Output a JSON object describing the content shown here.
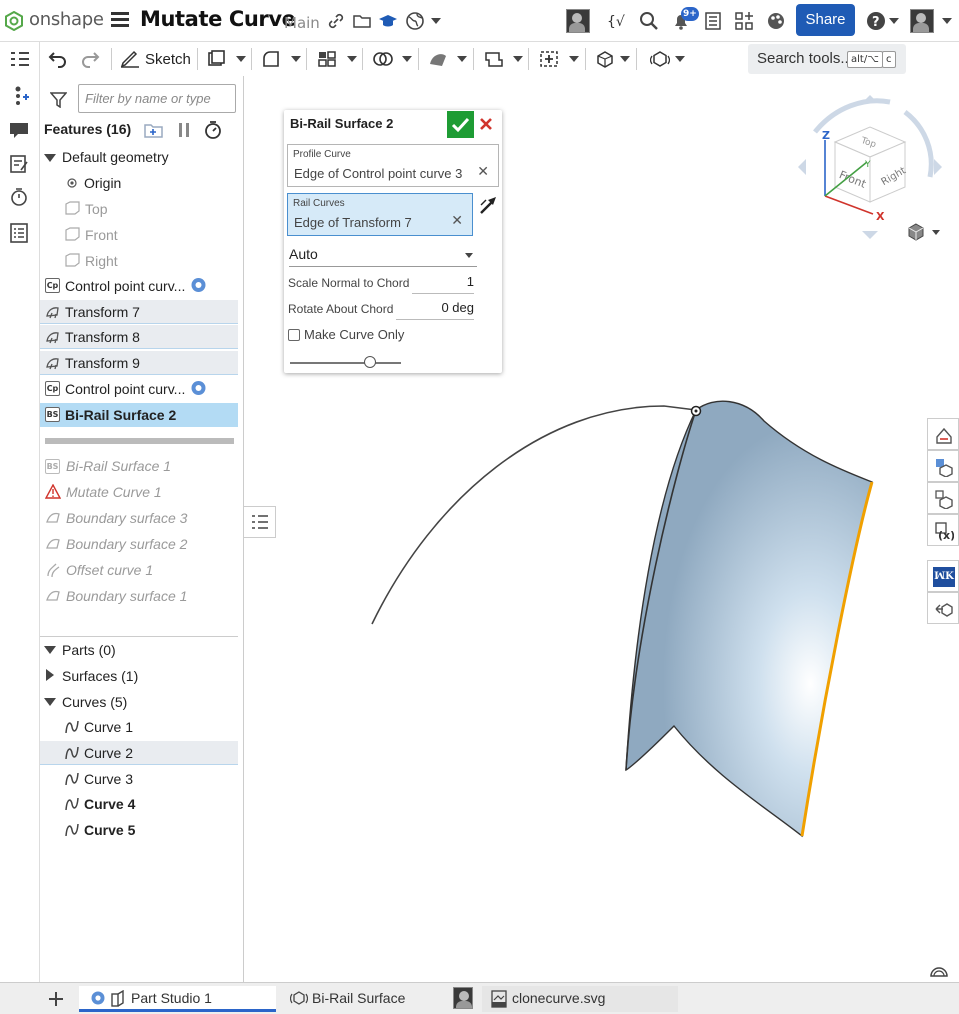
{
  "app": {
    "brand": "onshape",
    "document_title": "Mutate Curve",
    "branch": "Main",
    "notification_count": "9+",
    "share_label": "Share"
  },
  "toolbar": {
    "sketch_label": "Sketch",
    "search_label": "Search tools...",
    "search_shortcut_1": "alt/⌥",
    "search_shortcut_2": "c"
  },
  "features": {
    "filter_placeholder": "Filter by name or type",
    "header": "Features (16)",
    "default_geometry": "Default geometry",
    "origin": "Origin",
    "planes": [
      "Top",
      "Front",
      "Right"
    ],
    "items": [
      {
        "icon": "Cp",
        "label": "Control point curv...",
        "state": "normal"
      },
      {
        "icon": "Tf",
        "label": "Transform 7",
        "state": "selected"
      },
      {
        "icon": "Tf",
        "label": "Transform 8",
        "state": "selected"
      },
      {
        "icon": "Tf",
        "label": "Transform 9",
        "state": "selected"
      },
      {
        "icon": "Cp",
        "label": "Control point curv...",
        "state": "normal"
      },
      {
        "icon": "BS",
        "label": "Bi-Rail Surface 2",
        "state": "active"
      }
    ],
    "rolled_back": [
      {
        "icon": "BS",
        "label": "Bi-Rail Surface 1"
      },
      {
        "icon": "warn",
        "label": "Mutate Curve 1"
      },
      {
        "icon": "bnd",
        "label": "Boundary surface 3"
      },
      {
        "icon": "bnd",
        "label": "Boundary surface 2"
      },
      {
        "icon": "off",
        "label": "Offset curve 1"
      },
      {
        "icon": "bnd",
        "label": "Boundary surface 1"
      }
    ],
    "parts": "Parts (0)",
    "surfaces": "Surfaces (1)",
    "curves_header": "Curves (5)",
    "curves": [
      {
        "label": "Curve 1",
        "bold": false,
        "selected": false
      },
      {
        "label": "Curve 2",
        "bold": false,
        "selected": true
      },
      {
        "label": "Curve 3",
        "bold": false,
        "selected": false
      },
      {
        "label": "Curve 4",
        "bold": true,
        "selected": false
      },
      {
        "label": "Curve 5",
        "bold": true,
        "selected": false
      }
    ]
  },
  "dialog": {
    "title": "Bi-Rail Surface 2",
    "profile_label": "Profile Curve",
    "profile_value": "Edge of Control point curve 3",
    "rail_label": "Rail Curves",
    "rail_value": "Edge of Transform 7",
    "mode": "Auto",
    "scale_label": "Scale Normal to Chord",
    "scale_value": "1",
    "rotate_label": "Rotate About Chord",
    "rotate_value": "0 deg",
    "make_curve_label": "Make Curve Only",
    "make_curve_checked": false,
    "slider_value": 0.72
  },
  "viewcube": {
    "top": "Top",
    "front": "Front",
    "right": "Right",
    "axis_x": "X",
    "axis_y": "Y",
    "axis_z": "Z"
  },
  "tabs": [
    {
      "label": "Part Studio 1",
      "active": true
    },
    {
      "label": "Bi-Rail Surface",
      "active": false
    },
    {
      "label": "clonecurve.svg",
      "active": false
    }
  ],
  "colors": {
    "accent": "#2b65c9",
    "ok": "#1e9c34",
    "cancel": "#d0342c",
    "surface": "#9cb8d2",
    "edge_highlight": "#f0a000",
    "selected_row": "#b3dbf4"
  }
}
